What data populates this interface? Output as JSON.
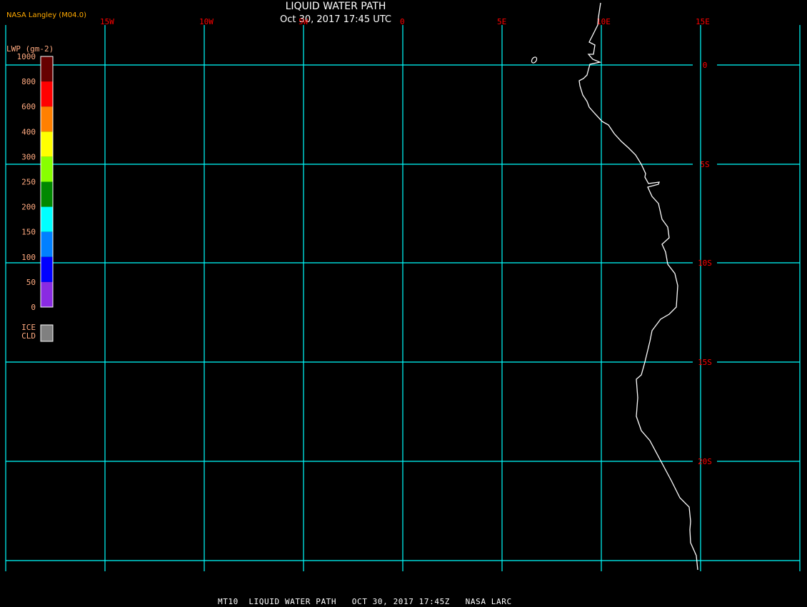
{
  "header": {
    "title": "LIQUID WATER PATH",
    "subtitle": "Oct 30, 2017 17:45 UTC",
    "credit": "NASA Langley (M04.0)"
  },
  "footer": "MT10  LIQUID WATER PATH   OCT 30, 2017 17:45Z   NASA LARC",
  "map": {
    "longitude_labels": [
      "15W",
      "10W",
      "5W",
      "0",
      "5E",
      "10E",
      "15E"
    ],
    "latitude_labels": [
      "0",
      "5S",
      "10S",
      "15S",
      "20S"
    ],
    "grid_color": "#00ffff",
    "label_color": "#ff0000",
    "coastline_color": "#ffffff"
  },
  "legend": {
    "title": "LWP (gm-2)",
    "tick_labels": [
      "1000",
      "800",
      "600",
      "400",
      "300",
      "250",
      "200",
      "150",
      "100",
      "50",
      "0"
    ],
    "colors": [
      "#660000",
      "#ff0000",
      "#ff8000",
      "#ffff00",
      "#88ff00",
      "#008800",
      "#00ffff",
      "#0080ff",
      "#0000ff",
      "#8a2be2"
    ],
    "ice_label_1": "ICE",
    "ice_label_2": "CLD",
    "ice_color": "#808080"
  }
}
